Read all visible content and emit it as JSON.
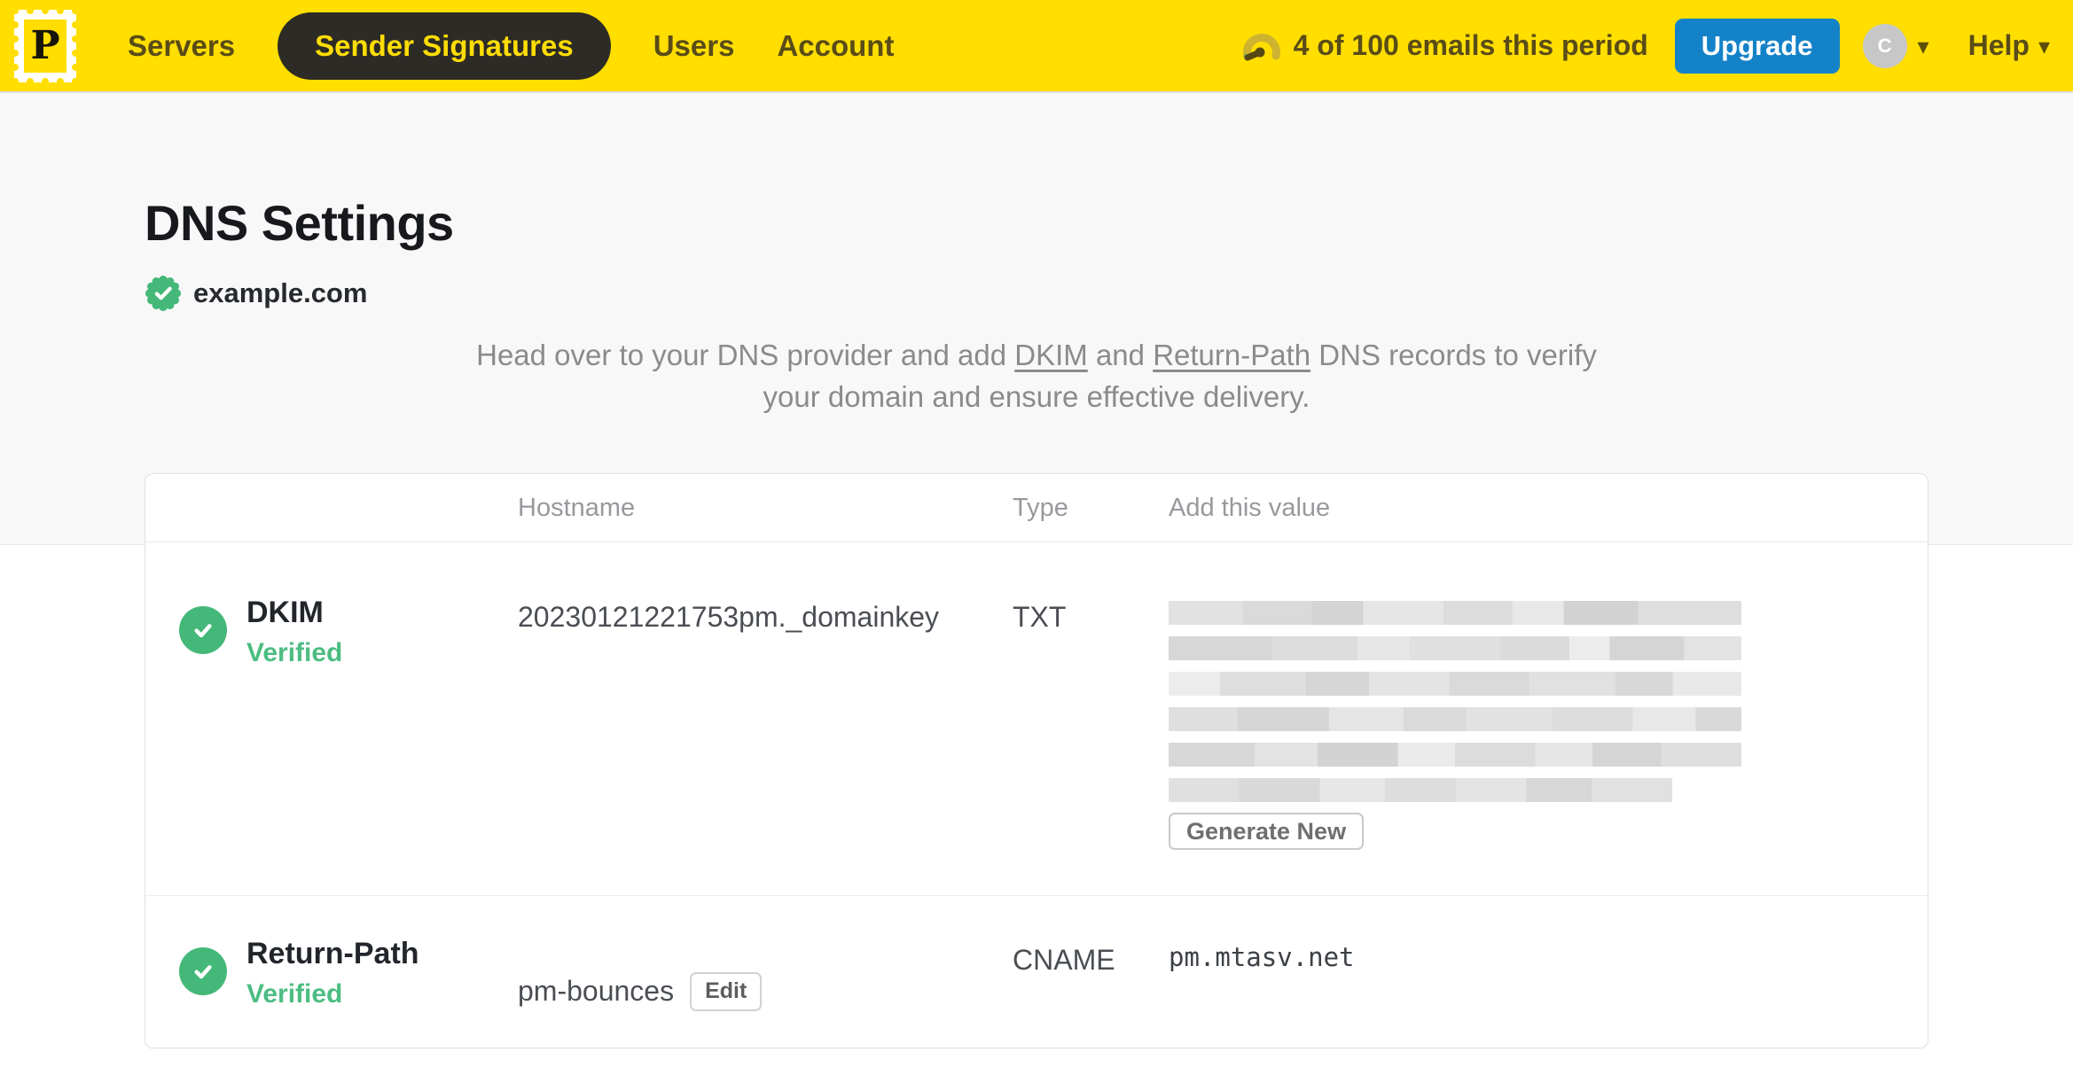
{
  "nav": {
    "logo_letter": "P",
    "items": [
      {
        "label": "Servers",
        "active": false
      },
      {
        "label": "Sender Signatures",
        "active": true
      },
      {
        "label": "Users",
        "active": false
      },
      {
        "label": "Account",
        "active": false
      }
    ],
    "usage_text": "4 of 100 emails this period",
    "upgrade_label": "Upgrade",
    "avatar_initial": "C",
    "help_label": "Help"
  },
  "page": {
    "title": "DNS Settings",
    "domain": "example.com",
    "domain_verified": true,
    "description": {
      "pre": "Head over to your DNS provider and add ",
      "link_dkim": "DKIM",
      "mid": " and ",
      "link_return_path": "Return-Path",
      "post": " DNS records to verify your domain and ensure effective delivery."
    }
  },
  "table": {
    "headers": {
      "hostname": "Hostname",
      "type": "Type",
      "value": "Add this value"
    },
    "rows": [
      {
        "name": "DKIM",
        "status": "Verified",
        "hostname": "20230121221753pm._domainkey",
        "type": "TXT",
        "value_redacted": true,
        "action_label": "Generate New"
      },
      {
        "name": "Return-Path",
        "status": "Verified",
        "hostname": "pm-bounces",
        "edit_label": "Edit",
        "type": "CNAME",
        "value": "pm.mtasv.net"
      }
    ]
  },
  "colors": {
    "brand_yellow": "#FFDE00",
    "nav_pill_bg": "#2D2B25",
    "nav_text": "#5A4C17",
    "upgrade_blue": "#1482C8",
    "verified_green": "#44B878",
    "description_gray": "#8B8B8D"
  }
}
